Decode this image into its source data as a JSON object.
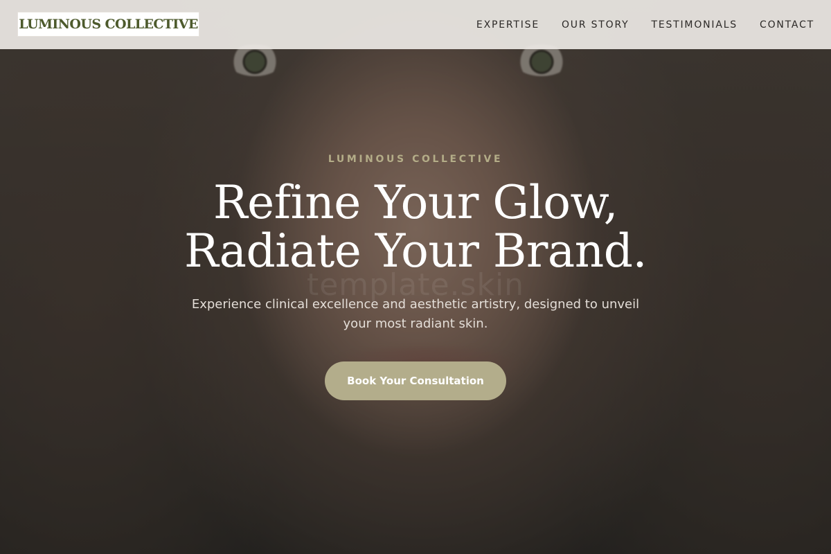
{
  "header": {
    "logo_text": "LUMINOUS COLLECTIVE",
    "nav": [
      {
        "label": "EXPERTISE"
      },
      {
        "label": "OUR STORY"
      },
      {
        "label": "TESTIMONIALS"
      },
      {
        "label": "CONTACT"
      }
    ]
  },
  "hero": {
    "eyebrow": "LUMINOUS COLLECTIVE",
    "headline_line1": "Refine Your Glow,",
    "headline_line2": "Radiate Your Brand.",
    "subtitle": "Experience clinical excellence and aesthetic artistry, designed to unveil your most radiant skin.",
    "cta_label": "Book Your Consultation",
    "watermark": "template.skin"
  },
  "colors": {
    "logo_text": "#4d5a2c",
    "accent": "#b3ad8b",
    "eyebrow": "#b4ad88",
    "header_bg": "#ece8e4"
  }
}
